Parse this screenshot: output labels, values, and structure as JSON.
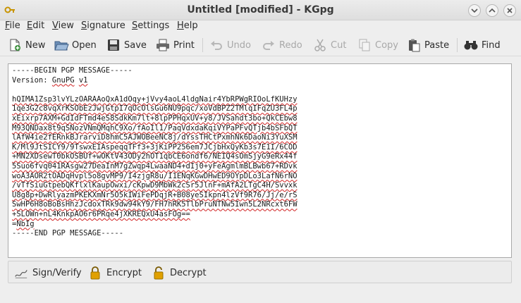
{
  "window": {
    "title": "Untitled [modified] - KGpg"
  },
  "menu": [
    {
      "label": "File",
      "accel": "F",
      "rest": "ile"
    },
    {
      "label": "Edit",
      "accel": "E",
      "rest": "dit"
    },
    {
      "label": "View",
      "accel": "V",
      "rest": "iew"
    },
    {
      "label": "Signature",
      "accel": "S",
      "rest": "ignature"
    },
    {
      "label": "Settings",
      "accel": "S",
      "rest": "ettings"
    },
    {
      "label": "Help",
      "accel": "H",
      "rest": "elp"
    }
  ],
  "toolbar": {
    "new": "New",
    "open": "Open",
    "save": "Save",
    "print": "Print",
    "undo": "Undo",
    "redo": "Redo",
    "cut": "Cut",
    "copy": "Copy",
    "paste": "Paste",
    "find": "Find"
  },
  "editor": {
    "begin": "-----BEGIN PGP MESSAGE-----",
    "version": "Version: GnuPG v1",
    "body": [
      "hQIMA1Zsp3lvYLzOARAAoQxA1dOqy+jVvy4aoL4ldgNair4YbRPWgRIOoLfKUHzy",
      "1qe3G2c8vqXrKSObEzJwjGtpI7qOcOlsGu6NU9pqc/xoVdBPZ2TMlqIFqZU3FL4p",
      "xEixrp7AXM+GdIdFTmd4eS8SdkKm7lt+8lpPPHqxUV+y8/JVSahdt3bo+QkCEbw8",
      "M93QNDax8t9qSNozVNmQMqhC9Xo/fAoIl1/PaqVdxdaKqiVYPaPFvQTjb4bSFbQT",
      "lAfW4ie2fERnkBJrarviD8hmC5AJWOBeeNC8j/dYssTHCtPxmhNk6DaoNi3YuXSM",
      "K/Ml9JtSICY9/9TswxEIAspeqqTFf3+3jKiPP256em7JCjbHxQyKb3s7E1I/6COD",
      "+MN2XDsewT0bkOSBUf+wOKtV43ODy2hOT1qbCE6ondf6/NEIQ4sOmSjyG9eRx44f",
      "5Suo6fvq041RAsgw27DeaInM7gZwqp4LwaaND4+dIj0+yFeAgmlmBLBwb67+RDvk",
      "woA3AOR2tOADqHvpl5o8gvMP9/I4zjgR8u/I1ENqKGwDHwED9OYpDLo3LafN6rNO",
      "/vTfSiuGtpebQKflxlKaupOwxi/cKpwD9MbWk2cSr5JlnF+mAfA2LTgC4H/Svvxk",
      "U8g8p+DwRlyazmPKEKXmNr5O5kIWiFePDqjR+B08yeSIkpn4lzVf9R76/Jj/e/rS",
      "SwHP6H8oBoBsHhzJcdoxTRk9dw94kY9/FH7hRK5TlbPruNTNw5Iwn5L2NRcxt6FW",
      "+SLOWn+nL4KnkpAO6r6PRqe4jXKREQxU4asFOg=="
    ],
    "checksum": "=NbIg",
    "end": "-----END PGP MESSAGE-----"
  },
  "actions": {
    "sign_verify": "Sign/Verify",
    "encrypt": "Encrypt",
    "decrypt": "Decrypt"
  },
  "colors": {
    "accent_lock": "#e0a000",
    "spell_underline": "#d02020"
  }
}
